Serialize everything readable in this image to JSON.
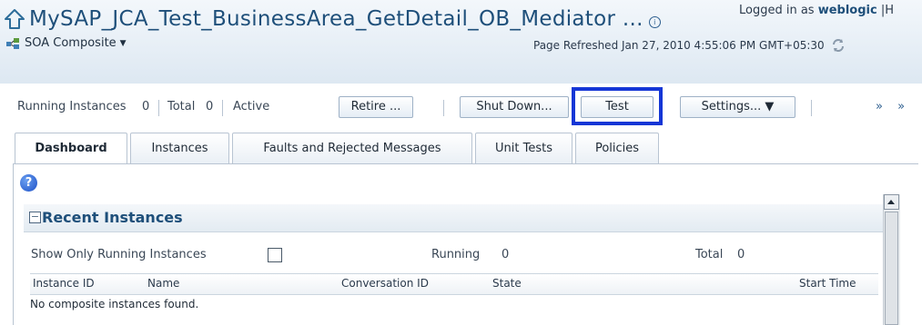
{
  "header": {
    "title": "MySAP_JCA_Test_BusinessArea_GetDetail_OB_Mediator ...",
    "logged_in_label": "Logged in as",
    "logged_in_user": "weblogic",
    "logged_in_trail": "|H",
    "composite_menu_label": "SOA Composite",
    "page_refreshed": "Page Refreshed Jan 27, 2010 4:55:06 PM GMT+05:30",
    "icons": [
      "home-icon",
      "help-icon",
      "composite-icon",
      "chevron-down-icon",
      "refresh-icon"
    ]
  },
  "toolbar": {
    "running_label": "Running Instances",
    "running_value": "0",
    "total_label": "Total",
    "total_value": "0",
    "active_label": "Active",
    "retire_label": "Retire ...",
    "shutdown_label": "Shut Down...",
    "test_label": "Test",
    "settings_label": "Settings... ▼",
    "more_label": "» »"
  },
  "tabs": [
    {
      "label": "Dashboard",
      "active": true
    },
    {
      "label": "Instances",
      "active": false
    },
    {
      "label": "Faults and Rejected Messages",
      "active": false
    },
    {
      "label": "Unit Tests",
      "active": false
    },
    {
      "label": "Policies",
      "active": false
    }
  ],
  "recent_instances": {
    "collapse_symbol": "−",
    "title": "Recent Instances",
    "show_only_running_label": "Show Only Running Instances",
    "show_only_running_checked": false,
    "running_label": "Running",
    "running_value": "0",
    "total_label": "Total",
    "total_value": "0",
    "columns": [
      "Instance ID",
      "Name",
      "Conversation ID",
      "State",
      "Start Time"
    ],
    "empty_message": "No composite instances found."
  },
  "highlight_color": "#1536d6",
  "header_title_color": "#1e4f7a"
}
